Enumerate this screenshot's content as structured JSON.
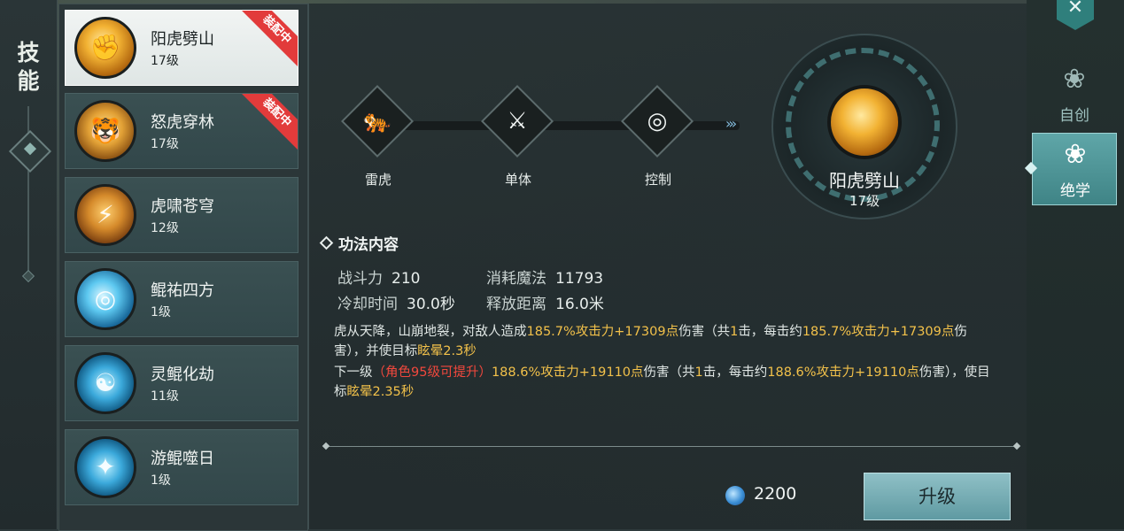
{
  "sidebar": {
    "title": "技能"
  },
  "skills": [
    {
      "name": "阳虎劈山",
      "level": "17级",
      "badge": "装配中",
      "icon": "tiger-fist-icon"
    },
    {
      "name": "怒虎穿林",
      "level": "17级",
      "badge": "装配中",
      "icon": "roaring-tiger-icon"
    },
    {
      "name": "虎啸苍穹",
      "level": "12级",
      "badge": "",
      "icon": "tiger-roar-icon"
    },
    {
      "name": "鲲祐四方",
      "level": "1级",
      "badge": "",
      "icon": "kun-sphere-icon"
    },
    {
      "name": "灵鲲化劫",
      "level": "11级",
      "badge": "",
      "icon": "spirit-kun-icon"
    },
    {
      "name": "游鲲噬日",
      "level": "1级",
      "badge": "",
      "icon": "swimming-kun-icon"
    }
  ],
  "traits": [
    {
      "label": "雷虎",
      "icon": "thunder-tiger-icon"
    },
    {
      "label": "单体",
      "icon": "single-target-icon"
    },
    {
      "label": "控制",
      "icon": "control-swirl-icon"
    }
  ],
  "selected": {
    "name": "阳虎劈山",
    "level": "17级"
  },
  "content": {
    "title": "功法内容",
    "stats": {
      "power_label": "战斗力",
      "power": "210",
      "mana_label": "消耗魔法",
      "mana": "11793",
      "cooldown_label": "冷却时间",
      "cooldown": "30.0秒",
      "range_label": "释放距离",
      "range": "16.0米"
    },
    "desc": {
      "p1": "虎从天降，山崩地裂，对敌人造成",
      "v1": "185.7%攻击力+17309点",
      "p2": "伤害（共",
      "v2": "1",
      "p3": "击，每击约",
      "v3": "185.7%攻击力+17309点",
      "p4": "伤害），并使目标",
      "v4": "眩晕2.3秒"
    },
    "next": {
      "p1": "下一级",
      "req": "（角色95级可提升）",
      "v1": "188.6%攻击力+19110点",
      "p2": "伤害（共",
      "v2": "1",
      "p3": "击，每击约",
      "v3": "188.6%攻击力+19110点",
      "p4": "伤害），使目标",
      "v4": "眩晕2.35秒"
    }
  },
  "cost": {
    "value": "2200",
    "icon": "spirit-orb-icon"
  },
  "upgrade_label": "升级",
  "tabs": [
    {
      "label": "自创",
      "active": false
    },
    {
      "label": "绝学",
      "active": true
    }
  ],
  "top_badge_icon": "x-emblem-icon"
}
